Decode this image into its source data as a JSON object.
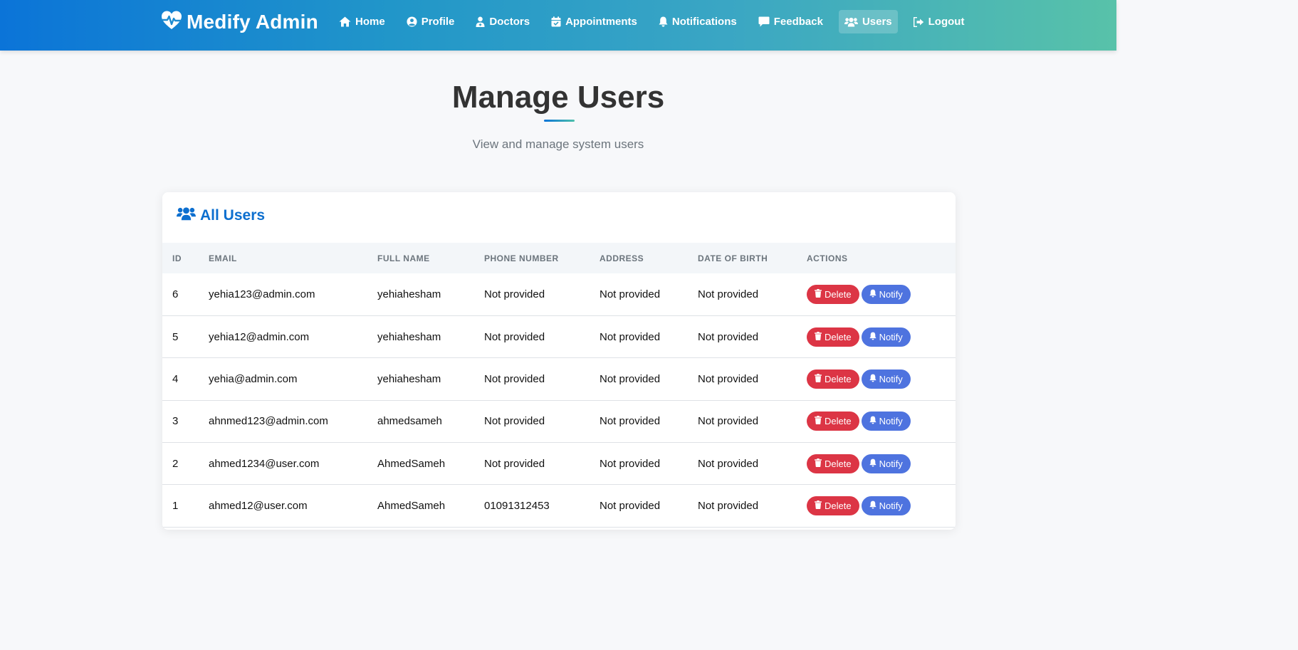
{
  "brand": {
    "name": "Medify Admin",
    "icon": "heart-pulse-icon"
  },
  "nav": {
    "items": [
      {
        "label": "Home",
        "icon": "home-icon"
      },
      {
        "label": "Profile",
        "icon": "user-circle-icon"
      },
      {
        "label": "Doctors",
        "icon": "user-doctor-icon"
      },
      {
        "label": "Appointments",
        "icon": "calendar-check-icon"
      },
      {
        "label": "Notifications",
        "icon": "bell-icon"
      },
      {
        "label": "Feedback",
        "icon": "comment-icon"
      },
      {
        "label": "Users",
        "icon": "users-icon",
        "active": true
      },
      {
        "label": "Logout",
        "icon": "sign-out-icon"
      }
    ]
  },
  "page": {
    "title": "Manage Users",
    "subtitle": "View and manage system users"
  },
  "card": {
    "title": "All Users",
    "icon": "users-icon",
    "columns": [
      "ID",
      "EMAIL",
      "FULL NAME",
      "PHONE NUMBER",
      "ADDRESS",
      "DATE OF BIRTH",
      "ACTIONS"
    ],
    "rows": [
      {
        "id": "6",
        "email": "yehia123@admin.com",
        "full_name": "yehiahesham",
        "phone": "Not provided",
        "address": "Not provided",
        "dob": "Not provided"
      },
      {
        "id": "5",
        "email": "yehia12@admin.com",
        "full_name": "yehiahesham",
        "phone": "Not provided",
        "address": "Not provided",
        "dob": "Not provided"
      },
      {
        "id": "4",
        "email": "yehia@admin.com",
        "full_name": "yehiahesham",
        "phone": "Not provided",
        "address": "Not provided",
        "dob": "Not provided"
      },
      {
        "id": "3",
        "email": "ahnmed123@admin.com",
        "full_name": "ahmedsameh",
        "phone": "Not provided",
        "address": "Not provided",
        "dob": "Not provided"
      },
      {
        "id": "2",
        "email": "ahmed1234@user.com",
        "full_name": "AhmedSameh",
        "phone": "Not provided",
        "address": "Not provided",
        "dob": "Not provided"
      },
      {
        "id": "1",
        "email": "ahmed12@user.com",
        "full_name": "AhmedSameh",
        "phone": "01091312453",
        "address": "Not provided",
        "dob": "Not provided"
      }
    ],
    "actions": {
      "delete_label": "Delete",
      "delete_icon": "trash-icon",
      "notify_label": "Notify",
      "notify_icon": "bell-icon"
    }
  },
  "colors": {
    "nav_gradient_start": "#0b74d8",
    "nav_gradient_end": "#58c2a9",
    "accent": "#0d6fcf",
    "delete": "#dc3545",
    "notify": "#4e73df"
  }
}
